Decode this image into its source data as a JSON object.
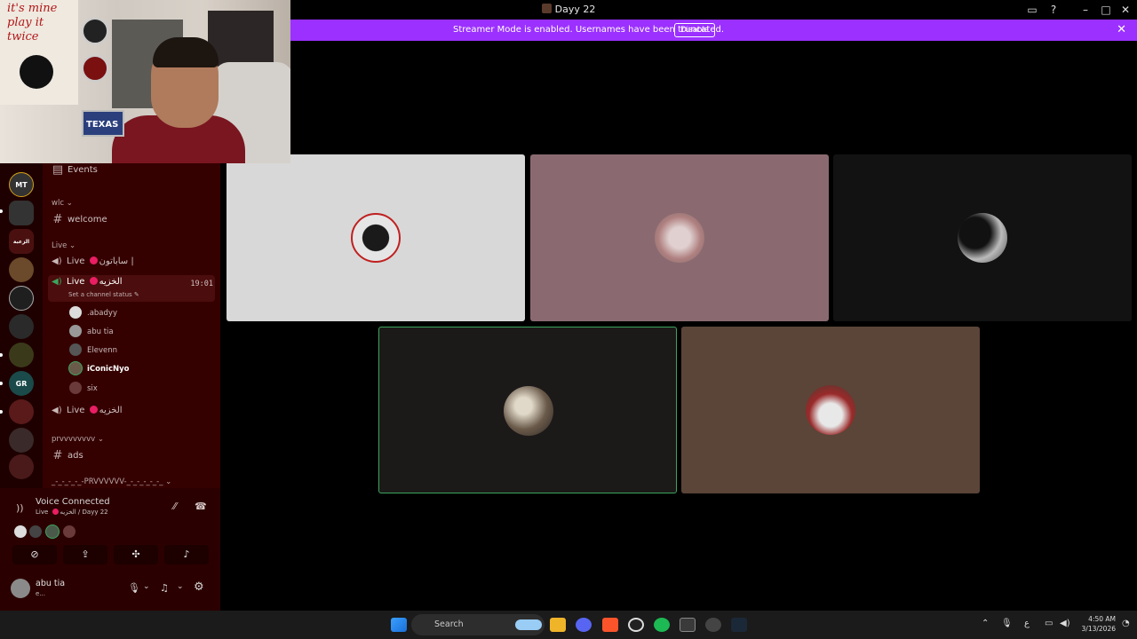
{
  "window": {
    "title": "Dayy 22"
  },
  "banner": {
    "message": "Streamer Mode is enabled. Usernames have been truncated.",
    "disable_label": "Disable",
    "color": "#9b30ff"
  },
  "webcam": {
    "wall_text": "it's mine play it twice",
    "sign_text": "TEXAS"
  },
  "servers": [
    {
      "label": "MT",
      "color": "#2a2a2a"
    },
    {
      "label": "",
      "color": "#3a2a1a"
    },
    {
      "label": "الزعبة",
      "color": "#4a1010"
    },
    {
      "label": "",
      "color": "#6a4a2a"
    },
    {
      "label": "",
      "color": "#1f1f1f"
    },
    {
      "label": "",
      "color": "#2a2a2a"
    },
    {
      "label": "",
      "color": "#3a3a1a"
    },
    {
      "label": "GR",
      "color": "#1a4a4a"
    },
    {
      "label": "",
      "color": "#5a1a1a"
    },
    {
      "label": "",
      "color": "#3a2a2a"
    },
    {
      "label": "",
      "color": "#4a1a1a"
    }
  ],
  "channels": {
    "events_label": "Events",
    "cat_wlc": "wlc",
    "welcome": "welcome",
    "cat_live": "Live",
    "live1_name": "Live",
    "live1_suffix": "ساباتون |",
    "live2_name": "Live",
    "live2_suffix": "الخزيه",
    "live2_time": "19:01",
    "live2_status": "Set a channel status",
    "voice_users": [
      ".abadyy",
      "abu tia",
      "Elevenn",
      "iConicNyo",
      "six"
    ],
    "live3_name": "Live",
    "live3_suffix": "الخزيه",
    "cat_prv": "prvvvvvvvv",
    "ads": "ads",
    "cat_prv2": "_-_-_-_-_-PRVVVVVV-_-_-_-_-_-_"
  },
  "voice_panel": {
    "title": "Voice Connected",
    "subtitle_live": "Live",
    "subtitle_channel": "الخزيه / Dayy 22"
  },
  "user": {
    "name": "abu tia",
    "status": "e..."
  },
  "taskbar": {
    "search_placeholder": "Search",
    "lang": "ع",
    "time": "4:50 AM",
    "date": "3/13/2026"
  }
}
